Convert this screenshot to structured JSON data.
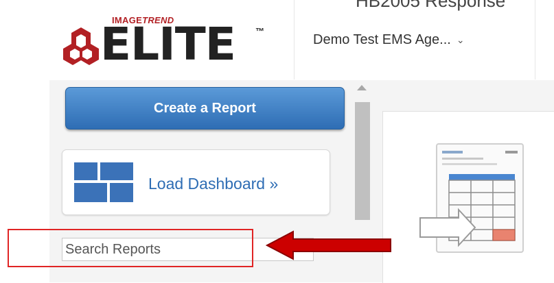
{
  "header": {
    "page_title": "HB2005 Response",
    "logo": {
      "brand": "IMAGETREND",
      "word": "ELITE",
      "tm": "™"
    },
    "agency_selector": {
      "label": "Demo Test EMS Age...",
      "caret_icon": "chevron-down-icon"
    }
  },
  "sidebar": {
    "create_report_label": "Create a Report",
    "load_dashboard_label": "Load Dashboard »",
    "search": {
      "placeholder": "Search Reports",
      "value": ""
    }
  },
  "annotation": {
    "highlight_color": "#e02424",
    "arrow_color": "#cc0000"
  },
  "colors": {
    "accent_blue": "#2e6db4",
    "brand_red": "#b22024"
  }
}
